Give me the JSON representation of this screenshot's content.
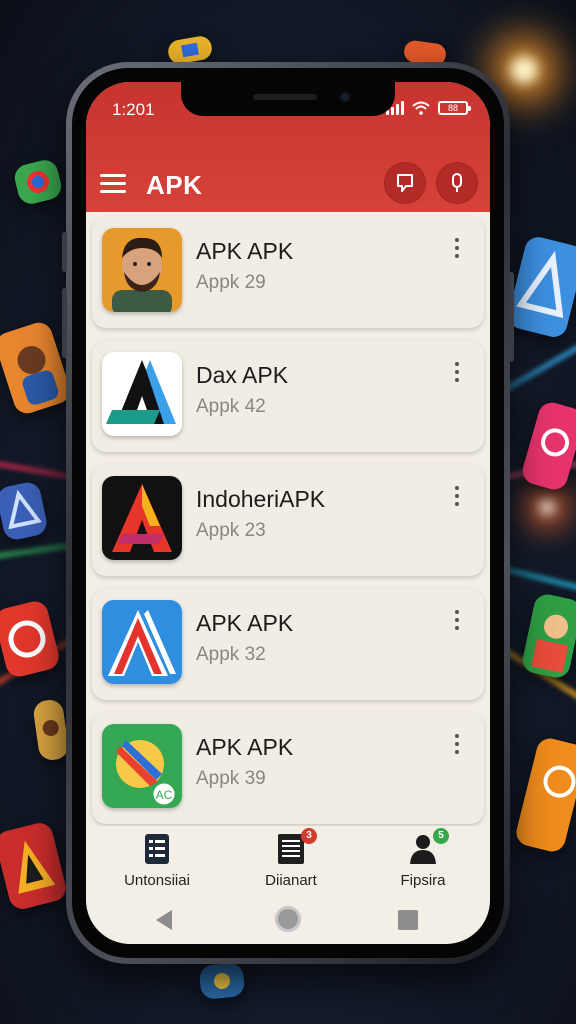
{
  "status_bar": {
    "time": "1:201",
    "battery": "88"
  },
  "app_bar": {
    "title": "APK",
    "colors": {
      "primary": "#d0372f",
      "primary_dark": "#b22b27"
    }
  },
  "apps": [
    {
      "name": "APK APK",
      "subtitle": "Appk 29",
      "icon": "man-avatar-icon"
    },
    {
      "name": "Dax APK",
      "subtitle": "Appk 42",
      "icon": "dax-a-logo-icon"
    },
    {
      "name": "IndoheriAPK",
      "subtitle": "Appk 23",
      "icon": "red-yellow-a-logo-icon"
    },
    {
      "name": "APK APK",
      "subtitle": "Appk 32",
      "icon": "blue-red-a-logo-icon"
    },
    {
      "name": "APK APK",
      "subtitle": "Appk 39",
      "icon": "green-compass-icon"
    }
  ],
  "bottom_nav": [
    {
      "label": "Untonsiiai",
      "icon": "list-icon",
      "badge": ""
    },
    {
      "label": "Diianart",
      "icon": "document-icon",
      "badge": "3",
      "badge_color": "#d33a2f"
    },
    {
      "label": "Fipsira",
      "icon": "person-icon",
      "badge": "5",
      "badge_color": "#38a84a"
    }
  ]
}
